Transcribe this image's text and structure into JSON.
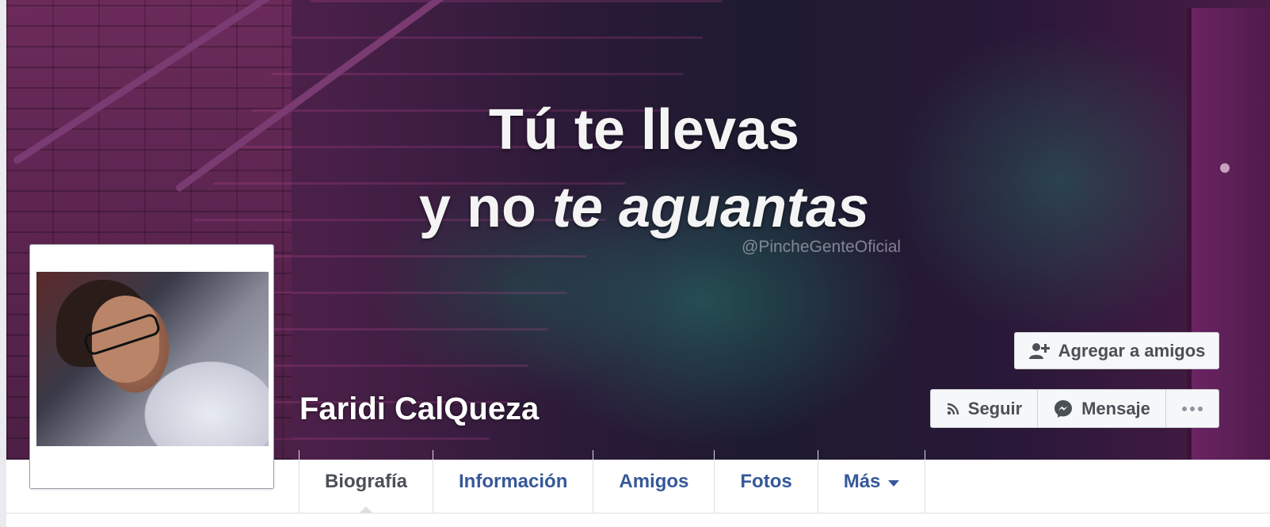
{
  "cover": {
    "quote_line1": "Tú te llevas",
    "quote_line2_a": "y no ",
    "quote_line2_b": "te aguantas",
    "watermark": "@PincheGenteOficial"
  },
  "profile": {
    "name": "Faridi CalQueza"
  },
  "actions": {
    "add_friend": "Agregar a amigos",
    "follow": "Seguir",
    "message": "Mensaje",
    "more": "..."
  },
  "tabs": [
    {
      "label": "Biografía",
      "active": true
    },
    {
      "label": "Información"
    },
    {
      "label": "Amigos"
    },
    {
      "label": "Fotos"
    },
    {
      "label": "Más"
    }
  ],
  "colors": {
    "link": "#365899",
    "active_tab": "#4b4f56",
    "button_bg": "#f6f7f9"
  },
  "icons": {
    "add_friend": "person-plus-icon",
    "follow": "rss-icon",
    "message": "messenger-icon",
    "more": "ellipsis-icon",
    "tab_more": "caret-down-icon"
  }
}
